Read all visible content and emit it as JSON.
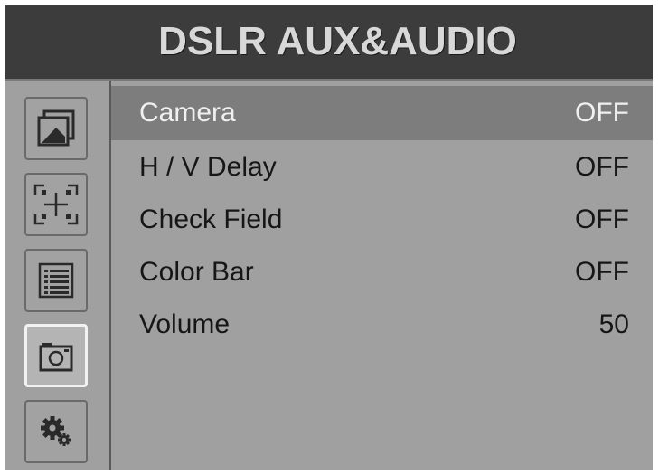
{
  "header": {
    "title": "DSLR AUX&AUDIO"
  },
  "sidebar": {
    "items": [
      {
        "icon": "picture-icon",
        "active": false
      },
      {
        "icon": "crosshair-frame-icon",
        "active": false
      },
      {
        "icon": "list-icon",
        "active": false
      },
      {
        "icon": "camera-icon",
        "active": true
      },
      {
        "icon": "gears-icon",
        "active": false
      }
    ]
  },
  "menu": {
    "items": [
      {
        "label": "Camera",
        "value": "OFF",
        "selected": true
      },
      {
        "label": "H / V Delay",
        "value": "OFF",
        "selected": false
      },
      {
        "label": "Check Field",
        "value": "OFF",
        "selected": false
      },
      {
        "label": "Color Bar",
        "value": "OFF",
        "selected": false
      },
      {
        "label": "Volume",
        "value": "50",
        "selected": false
      }
    ]
  },
  "colors": {
    "title_bar": "#3c3c3c",
    "panel": "#a0a0a0",
    "selection": "#7d7d7d",
    "active_border": "#f2f2f2"
  }
}
